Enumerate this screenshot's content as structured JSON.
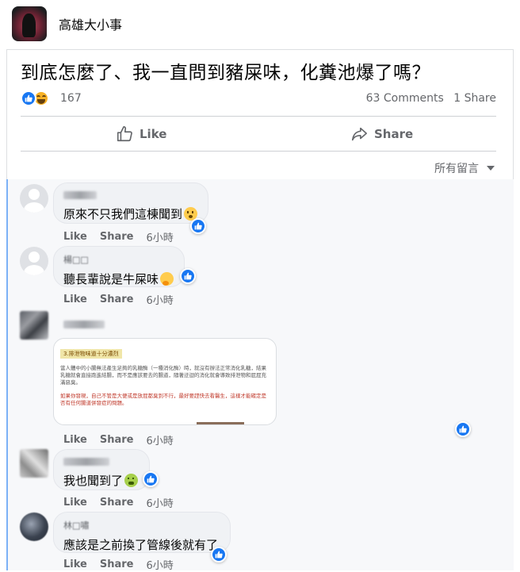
{
  "header": {
    "page_name": "高雄大小事"
  },
  "post": {
    "title": "到底怎麼了、我一直問到豬屎味，化糞池爆了嗎？",
    "reaction_count": "167",
    "comments_count": "63 Comments",
    "shares_count": "1 Share",
    "like_label": "Like",
    "share_label": "Share"
  },
  "sort": {
    "label": "所有留言"
  },
  "comment_actions": {
    "like": "Like",
    "share": "Share"
  },
  "comments": [
    {
      "text": "原來不只我們這棟聞到",
      "time": "6小時"
    },
    {
      "author": "楊□□",
      "text": "聽長輩說是牛屎味",
      "time": "6小時"
    },
    {
      "time": "6小時",
      "image_heading": "3.排泄物味道十分濃烈",
      "image_para1": "當人體中的小腸無法產生足夠的乳糖酶（一種消化酶）時，就沒有辦法正常消化乳糖，結果乳糖就會直接跑進結腸，而不是應該要去的腸道，隨著迂迴的消化就會導致排泄物和屁屁充滿惡臭。",
      "image_para2": "如果你發現，自己不管是大便或是放屁都臭到不行，最好要趕快去看醫生，這樣才能確定是否有任何腸道併發症的問題。"
    },
    {
      "text": "我也聞到了",
      "time": "6小時"
    },
    {
      "author": "林□嘯",
      "text": "應該是之前換了管線後就有了",
      "time": "6小時"
    }
  ],
  "colors": {
    "accent": "#1877f2",
    "secondary_text": "#65676b"
  }
}
